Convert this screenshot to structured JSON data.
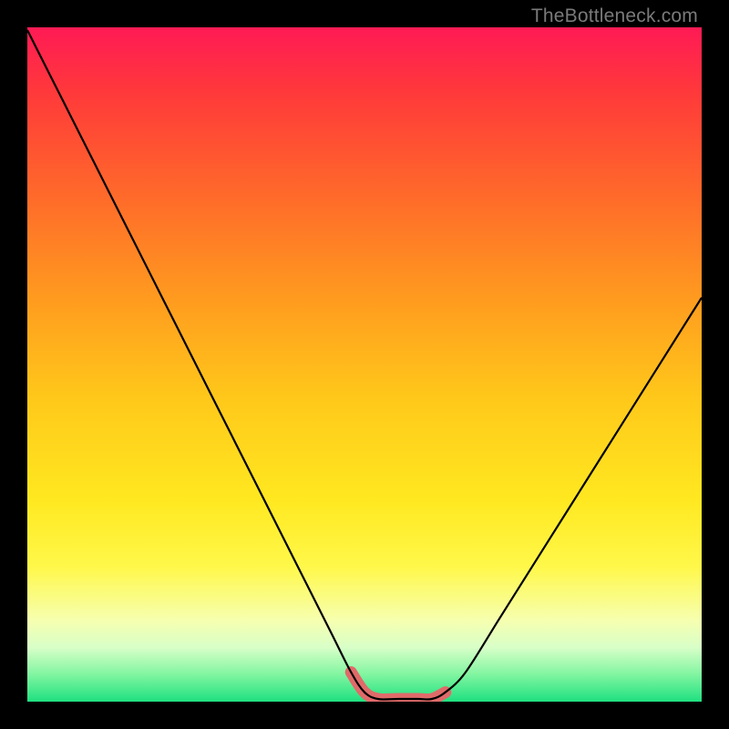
{
  "watermark": "TheBottleneck.com",
  "chart_data": {
    "type": "line",
    "title": "",
    "xlabel": "",
    "ylabel": "",
    "xlim": [
      0,
      100
    ],
    "ylim": [
      0,
      100
    ],
    "x": [
      0,
      5,
      10,
      15,
      20,
      25,
      30,
      35,
      40,
      45,
      48,
      50,
      52,
      55,
      58,
      60,
      62,
      65,
      70,
      75,
      80,
      85,
      90,
      95,
      100
    ],
    "values": [
      100,
      90,
      80,
      70,
      60,
      50,
      40,
      30,
      20,
      10,
      4,
      1,
      0,
      0,
      0,
      0,
      1,
      4,
      12,
      20,
      28,
      36,
      44,
      52,
      60
    ],
    "gradient_stops": [
      {
        "offset": 0.0,
        "color": "#ff1a55"
      },
      {
        "offset": 0.1,
        "color": "#ff3a3a"
      },
      {
        "offset": 0.25,
        "color": "#ff6a2a"
      },
      {
        "offset": 0.4,
        "color": "#ff9a1f"
      },
      {
        "offset": 0.55,
        "color": "#ffc81a"
      },
      {
        "offset": 0.7,
        "color": "#ffe820"
      },
      {
        "offset": 0.8,
        "color": "#fff84a"
      },
      {
        "offset": 0.88,
        "color": "#f6ffb0"
      },
      {
        "offset": 0.92,
        "color": "#d8ffc8"
      },
      {
        "offset": 0.96,
        "color": "#80f5a0"
      },
      {
        "offset": 1.0,
        "color": "#1ee080"
      }
    ],
    "highlight": {
      "color": "#e06a6a",
      "x_start": 48,
      "x_end": 62
    }
  }
}
